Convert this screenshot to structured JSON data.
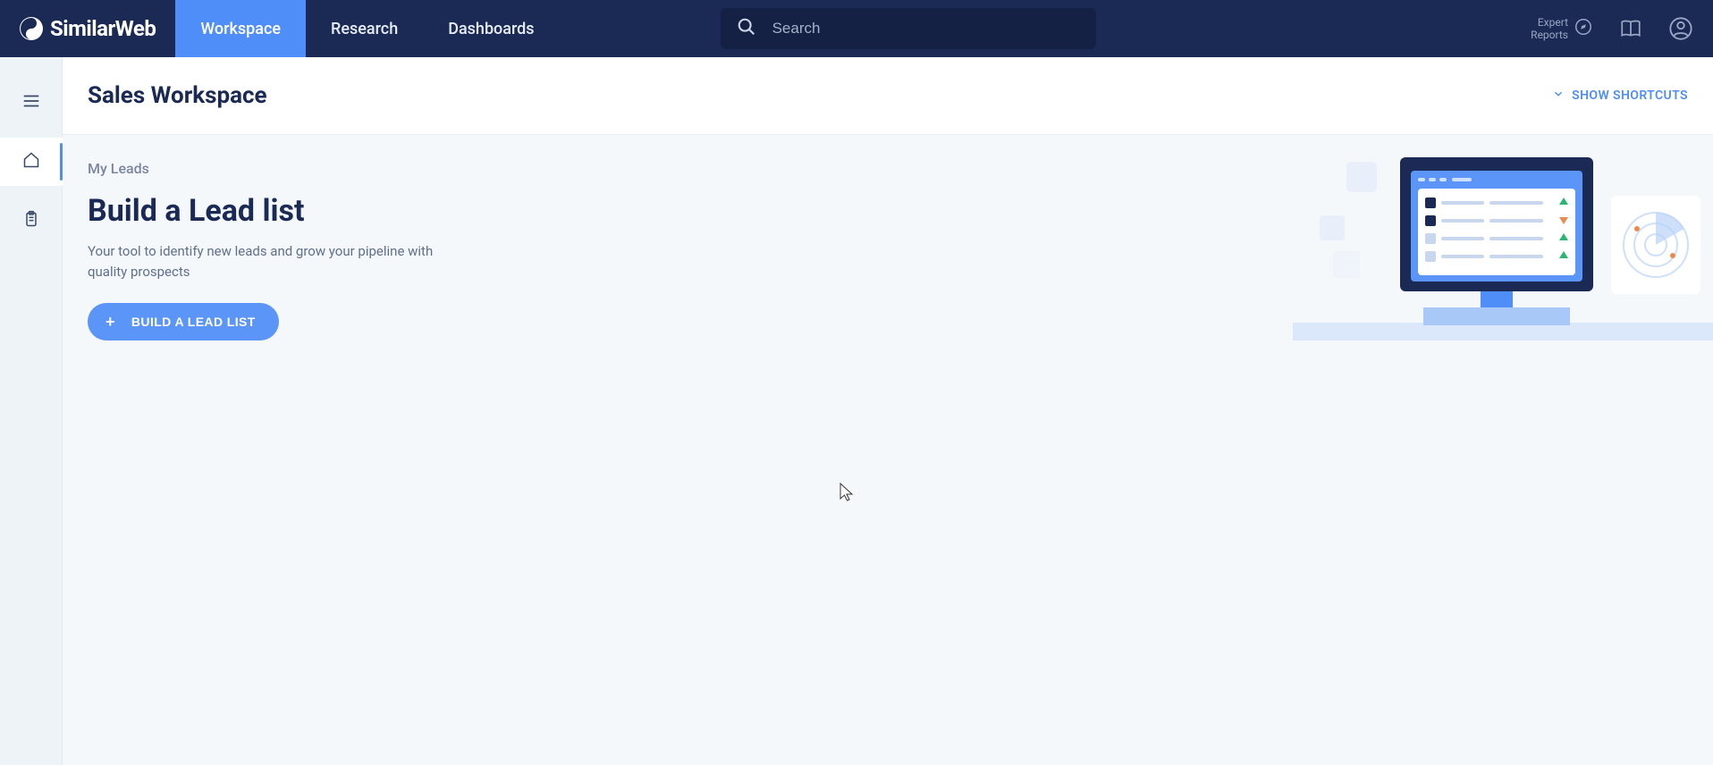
{
  "brand": "SimilarWeb",
  "nav": {
    "tabs": [
      {
        "label": "Workspace",
        "active": true
      },
      {
        "label": "Research",
        "active": false
      },
      {
        "label": "Dashboards",
        "active": false
      }
    ]
  },
  "search": {
    "placeholder": "Search"
  },
  "topright": {
    "expert_line1": "Expert",
    "expert_line2": "Reports"
  },
  "page": {
    "title": "Sales Workspace",
    "shortcuts_label": "SHOW SHORTCUTS"
  },
  "leads": {
    "section_label": "My Leads",
    "title": "Build a Lead list",
    "description": "Your tool to identify new leads and grow your pipeline with quality prospects",
    "cta_label": "BUILD A LEAD LIST"
  }
}
